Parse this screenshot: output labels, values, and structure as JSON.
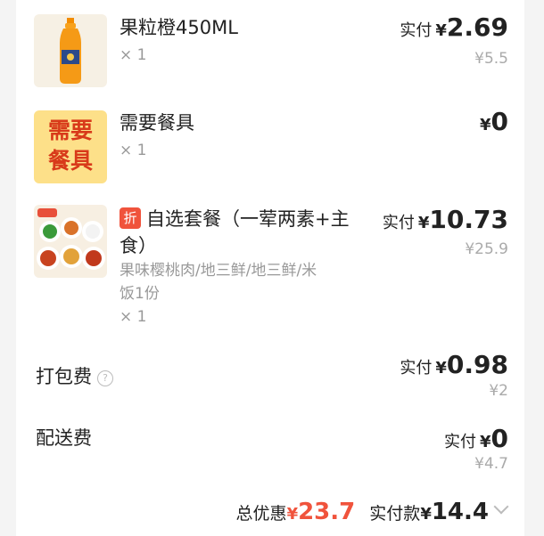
{
  "items": [
    {
      "name": "果粒橙450ML",
      "qty": "× 1",
      "paid_label": "实付",
      "currency": "¥",
      "paid": "2.69",
      "original": "¥5.5",
      "image": "orange-juice-bottle"
    },
    {
      "name": "需要餐具",
      "qty": "× 1",
      "currency": "¥",
      "paid": "0",
      "image_text": [
        "需要",
        "餐具"
      ]
    },
    {
      "discount_tag": "折",
      "name_line1": "自选套餐（一荤两素+主",
      "name_line2": "食）",
      "spec_line1": "果味樱桃肉/地三鲜/地三鲜/米",
      "spec_line2": "饭1份",
      "qty": "× 1",
      "paid_label": "实付",
      "currency": "¥",
      "paid": "10.73",
      "original": "¥25.9",
      "image": "combo-meal-dishes"
    }
  ],
  "fees": [
    {
      "label": "打包费",
      "help_icon": "question-circle-icon",
      "paid_label": "实付",
      "currency": "¥",
      "paid": "0.98",
      "original": "¥2"
    },
    {
      "label": "配送费",
      "paid_label": "实付",
      "currency": "¥",
      "paid": "0",
      "original": "¥4.7"
    }
  ],
  "summary": {
    "discount_label": "总优惠",
    "discount_currency": "¥",
    "discount_value": "23.7",
    "total_label": "实付款",
    "total_currency": "¥",
    "total_value": "14.4"
  },
  "colors": {
    "accent": "#f0533c",
    "tableware_bg": "#fde089",
    "tableware_text": "#d83a1a"
  }
}
